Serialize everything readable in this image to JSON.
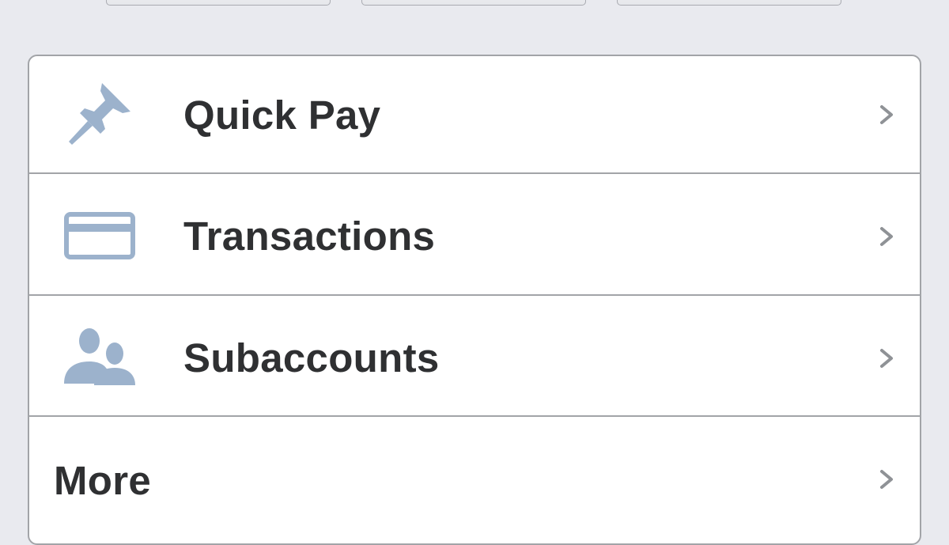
{
  "colors": {
    "background": "#e9eaef",
    "card": "#ffffff",
    "border": "#a2a4a8",
    "label": "#2f3032",
    "icon": "#9cb2cc",
    "chevron": "#8f9296"
  },
  "top_buttons": [
    {
      "icon": "button-partial"
    },
    {
      "icon": "button-partial"
    },
    {
      "icon": "button-partial"
    }
  ],
  "menu": {
    "items": [
      {
        "label": "Quick Pay",
        "icon": "pushpin-icon"
      },
      {
        "label": "Transactions",
        "icon": "credit-card-icon"
      },
      {
        "label": "Subaccounts",
        "icon": "users-icon"
      },
      {
        "label": "More",
        "icon": ""
      }
    ]
  }
}
